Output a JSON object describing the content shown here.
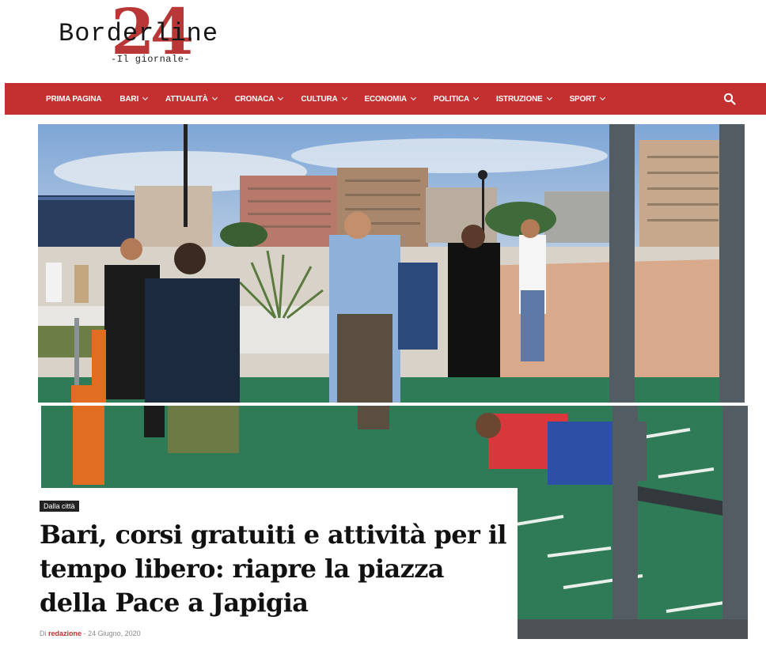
{
  "logo": {
    "wordmark": "Borderline",
    "number": "24",
    "tagline": "-Il giornale-"
  },
  "nav": {
    "items": [
      {
        "label": "PRIMA PAGINA",
        "dropdown": false
      },
      {
        "label": "BARI",
        "dropdown": true
      },
      {
        "label": "ATTUALITÀ",
        "dropdown": true
      },
      {
        "label": "CRONACA",
        "dropdown": true
      },
      {
        "label": "CULTURA",
        "dropdown": true
      },
      {
        "label": "ECONOMIA",
        "dropdown": true
      },
      {
        "label": "POLITICA",
        "dropdown": true
      },
      {
        "label": "ISTRUZIONE",
        "dropdown": true
      },
      {
        "label": "SPORT",
        "dropdown": true
      }
    ],
    "search_icon": "search-icon"
  },
  "colors": {
    "brand_red": "#c42f2f",
    "logo_red": "#b42727"
  },
  "article": {
    "category": "Dalla città",
    "title": "Bari, corsi gratuiti e attività per il tempo libero: riapre la piazza della Pace a Japigia",
    "author_prefix": "Di",
    "author": "redazione",
    "separator": "-",
    "date": "24 Giugno, 2020"
  }
}
